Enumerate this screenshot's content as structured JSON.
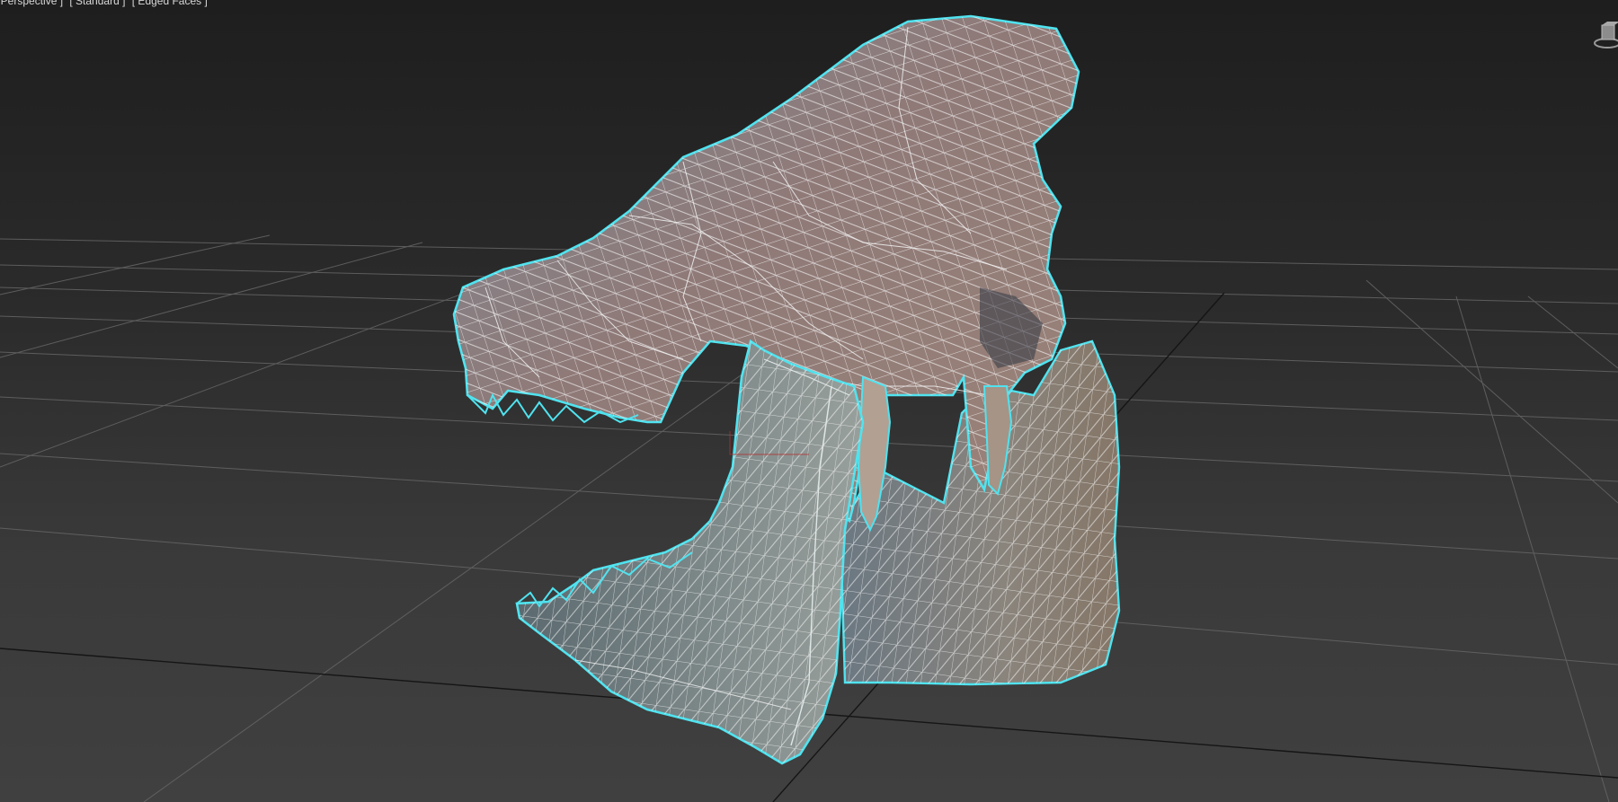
{
  "viewport": {
    "labels": {
      "view": "[ Perspective ]",
      "shading": "[ Standard ]",
      "display": "[ Edged Faces ]"
    },
    "colors": {
      "selection_outline": "#4fe3ef",
      "wireframe": "#f2f2f2",
      "grid": "#6a6a6a",
      "grid_axis": "#111111"
    },
    "icons": {
      "viewcube": "viewcube-icon"
    }
  }
}
